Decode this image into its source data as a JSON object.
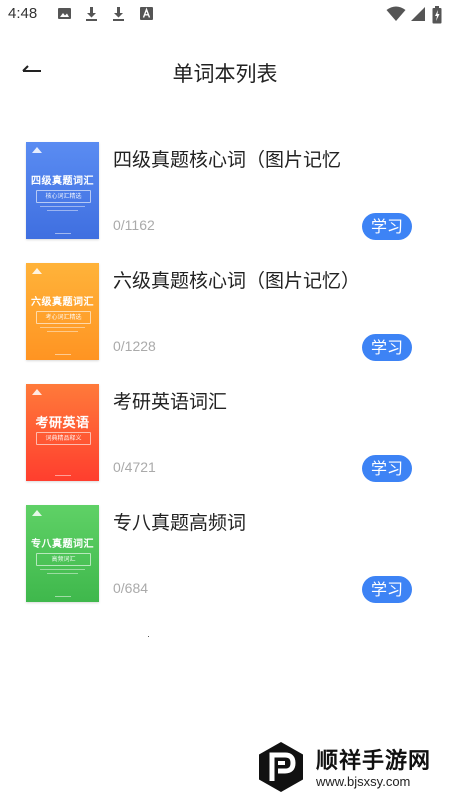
{
  "status_bar": {
    "time": "4:48",
    "left_icons": [
      "image-icon",
      "download-icon",
      "download-icon",
      "font-icon"
    ],
    "right_icons": [
      "wifi-icon",
      "signal-icon",
      "battery-icon"
    ]
  },
  "header": {
    "title": "单词本列表",
    "back_icon": "back-arrow-icon"
  },
  "books": [
    {
      "title": "四级真题核心词（图片记忆",
      "progress": "0/1162",
      "button": "学习",
      "cover": {
        "title": "四级真题词汇",
        "subtitle": "核心词汇精选",
        "color_top": "#5a8cf2",
        "color_bottom": "#3f6fe0"
      }
    },
    {
      "title": "六级真题核心词（图片记忆）",
      "progress": "0/1228",
      "button": "学习",
      "cover": {
        "title": "六级真题词汇",
        "subtitle": "考心词汇精选",
        "color_top": "#ffb33a",
        "color_bottom": "#ff9422"
      }
    },
    {
      "title": "考研英语词汇",
      "progress": "0/4721",
      "button": "学习",
      "cover": {
        "title": "考研英语",
        "subtitle": "词典精品释义",
        "color_top": "#ff7a3a",
        "color_bottom": "#ff3e2e"
      }
    },
    {
      "title": "专八真题高频词",
      "progress": "0/684",
      "button": "学习",
      "cover": {
        "title": "专八真题词汇",
        "subtitle": "高频词汇",
        "color_top": "#5fd166",
        "color_bottom": "#3fb84c"
      }
    }
  ],
  "watermark": {
    "name": "顺祥手游网",
    "url": "www.bjsxsy.com"
  },
  "colors": {
    "accent": "#3d83f5",
    "title_text": "#222222",
    "muted_text": "#aaaaaa"
  }
}
